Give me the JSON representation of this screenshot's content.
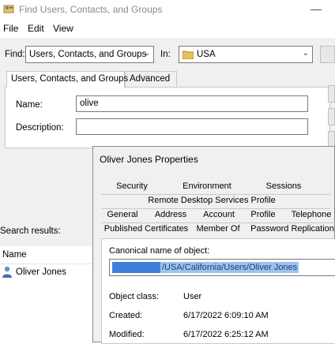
{
  "window": {
    "title": "Find Users, Contacts, and Groups",
    "minimize_glyph": "—"
  },
  "menu": [
    "File",
    "Edit",
    "View"
  ],
  "find": {
    "find_label": "Find:",
    "find_value": "Users, Contacts, and Groups",
    "in_label": "In:",
    "in_value": "USA",
    "in_icon": "folder-icon"
  },
  "tabs": [
    "Users, Contacts, and Groups",
    "Advanced"
  ],
  "form": {
    "name_label": "Name:",
    "name_value": "olive",
    "description_label": "Description:",
    "description_value": ""
  },
  "results": {
    "label": "Search results:",
    "column_name": "Name",
    "rows": [
      {
        "name": "Oliver Jones",
        "icon": "user-icon"
      }
    ]
  },
  "properties": {
    "title": "Oliver Jones Properties",
    "tab_rows": [
      [
        "Security",
        "Environment",
        "Sessions"
      ],
      [
        "Remote Desktop Services Profile"
      ],
      [
        "General",
        "Address",
        "Account",
        "Profile",
        "Telephone"
      ],
      [
        "Published Certificates",
        "Member Of",
        "Password Replication"
      ]
    ],
    "canonical_label": "Canonical name of object:",
    "canonical_value": "/USA/California/Users/Oliver Jones",
    "object_class_label": "Object class:",
    "object_class_value": "User",
    "created_label": "Created:",
    "created_value": "6/17/2022 6:09:10 AM",
    "modified_label": "Modified:",
    "modified_value": "6/17/2022 6:25:12 AM"
  },
  "colors": {
    "selection": "#9cc3f0",
    "redaction": "#3f7fd9",
    "panel": "#f0f0f0"
  }
}
